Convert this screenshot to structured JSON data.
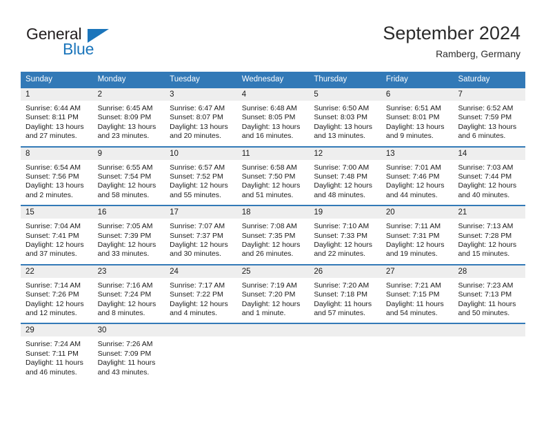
{
  "brand": {
    "name_dark": "General",
    "name_blue": "Blue",
    "accent_color": "#1b75bb"
  },
  "header": {
    "title": "September 2024",
    "subtitle": "Ramberg, Germany"
  },
  "theme": {
    "header_blue": "#3279b7",
    "day_band_gray": "#eeeeee",
    "text": "#1a1a1a"
  },
  "weekdays": [
    "Sunday",
    "Monday",
    "Tuesday",
    "Wednesday",
    "Thursday",
    "Friday",
    "Saturday"
  ],
  "weeks": [
    [
      {
        "day": "1",
        "sunrise": "Sunrise: 6:44 AM",
        "sunset": "Sunset: 8:11 PM",
        "daylight_line1": "Daylight: 13 hours",
        "daylight_line2": "and 27 minutes."
      },
      {
        "day": "2",
        "sunrise": "Sunrise: 6:45 AM",
        "sunset": "Sunset: 8:09 PM",
        "daylight_line1": "Daylight: 13 hours",
        "daylight_line2": "and 23 minutes."
      },
      {
        "day": "3",
        "sunrise": "Sunrise: 6:47 AM",
        "sunset": "Sunset: 8:07 PM",
        "daylight_line1": "Daylight: 13 hours",
        "daylight_line2": "and 20 minutes."
      },
      {
        "day": "4",
        "sunrise": "Sunrise: 6:48 AM",
        "sunset": "Sunset: 8:05 PM",
        "daylight_line1": "Daylight: 13 hours",
        "daylight_line2": "and 16 minutes."
      },
      {
        "day": "5",
        "sunrise": "Sunrise: 6:50 AM",
        "sunset": "Sunset: 8:03 PM",
        "daylight_line1": "Daylight: 13 hours",
        "daylight_line2": "and 13 minutes."
      },
      {
        "day": "6",
        "sunrise": "Sunrise: 6:51 AM",
        "sunset": "Sunset: 8:01 PM",
        "daylight_line1": "Daylight: 13 hours",
        "daylight_line2": "and 9 minutes."
      },
      {
        "day": "7",
        "sunrise": "Sunrise: 6:52 AM",
        "sunset": "Sunset: 7:59 PM",
        "daylight_line1": "Daylight: 13 hours",
        "daylight_line2": "and 6 minutes."
      }
    ],
    [
      {
        "day": "8",
        "sunrise": "Sunrise: 6:54 AM",
        "sunset": "Sunset: 7:56 PM",
        "daylight_line1": "Daylight: 13 hours",
        "daylight_line2": "and 2 minutes."
      },
      {
        "day": "9",
        "sunrise": "Sunrise: 6:55 AM",
        "sunset": "Sunset: 7:54 PM",
        "daylight_line1": "Daylight: 12 hours",
        "daylight_line2": "and 58 minutes."
      },
      {
        "day": "10",
        "sunrise": "Sunrise: 6:57 AM",
        "sunset": "Sunset: 7:52 PM",
        "daylight_line1": "Daylight: 12 hours",
        "daylight_line2": "and 55 minutes."
      },
      {
        "day": "11",
        "sunrise": "Sunrise: 6:58 AM",
        "sunset": "Sunset: 7:50 PM",
        "daylight_line1": "Daylight: 12 hours",
        "daylight_line2": "and 51 minutes."
      },
      {
        "day": "12",
        "sunrise": "Sunrise: 7:00 AM",
        "sunset": "Sunset: 7:48 PM",
        "daylight_line1": "Daylight: 12 hours",
        "daylight_line2": "and 48 minutes."
      },
      {
        "day": "13",
        "sunrise": "Sunrise: 7:01 AM",
        "sunset": "Sunset: 7:46 PM",
        "daylight_line1": "Daylight: 12 hours",
        "daylight_line2": "and 44 minutes."
      },
      {
        "day": "14",
        "sunrise": "Sunrise: 7:03 AM",
        "sunset": "Sunset: 7:44 PM",
        "daylight_line1": "Daylight: 12 hours",
        "daylight_line2": "and 40 minutes."
      }
    ],
    [
      {
        "day": "15",
        "sunrise": "Sunrise: 7:04 AM",
        "sunset": "Sunset: 7:41 PM",
        "daylight_line1": "Daylight: 12 hours",
        "daylight_line2": "and 37 minutes."
      },
      {
        "day": "16",
        "sunrise": "Sunrise: 7:05 AM",
        "sunset": "Sunset: 7:39 PM",
        "daylight_line1": "Daylight: 12 hours",
        "daylight_line2": "and 33 minutes."
      },
      {
        "day": "17",
        "sunrise": "Sunrise: 7:07 AM",
        "sunset": "Sunset: 7:37 PM",
        "daylight_line1": "Daylight: 12 hours",
        "daylight_line2": "and 30 minutes."
      },
      {
        "day": "18",
        "sunrise": "Sunrise: 7:08 AM",
        "sunset": "Sunset: 7:35 PM",
        "daylight_line1": "Daylight: 12 hours",
        "daylight_line2": "and 26 minutes."
      },
      {
        "day": "19",
        "sunrise": "Sunrise: 7:10 AM",
        "sunset": "Sunset: 7:33 PM",
        "daylight_line1": "Daylight: 12 hours",
        "daylight_line2": "and 22 minutes."
      },
      {
        "day": "20",
        "sunrise": "Sunrise: 7:11 AM",
        "sunset": "Sunset: 7:31 PM",
        "daylight_line1": "Daylight: 12 hours",
        "daylight_line2": "and 19 minutes."
      },
      {
        "day": "21",
        "sunrise": "Sunrise: 7:13 AM",
        "sunset": "Sunset: 7:28 PM",
        "daylight_line1": "Daylight: 12 hours",
        "daylight_line2": "and 15 minutes."
      }
    ],
    [
      {
        "day": "22",
        "sunrise": "Sunrise: 7:14 AM",
        "sunset": "Sunset: 7:26 PM",
        "daylight_line1": "Daylight: 12 hours",
        "daylight_line2": "and 12 minutes."
      },
      {
        "day": "23",
        "sunrise": "Sunrise: 7:16 AM",
        "sunset": "Sunset: 7:24 PM",
        "daylight_line1": "Daylight: 12 hours",
        "daylight_line2": "and 8 minutes."
      },
      {
        "day": "24",
        "sunrise": "Sunrise: 7:17 AM",
        "sunset": "Sunset: 7:22 PM",
        "daylight_line1": "Daylight: 12 hours",
        "daylight_line2": "and 4 minutes."
      },
      {
        "day": "25",
        "sunrise": "Sunrise: 7:19 AM",
        "sunset": "Sunset: 7:20 PM",
        "daylight_line1": "Daylight: 12 hours",
        "daylight_line2": "and 1 minute."
      },
      {
        "day": "26",
        "sunrise": "Sunrise: 7:20 AM",
        "sunset": "Sunset: 7:18 PM",
        "daylight_line1": "Daylight: 11 hours",
        "daylight_line2": "and 57 minutes."
      },
      {
        "day": "27",
        "sunrise": "Sunrise: 7:21 AM",
        "sunset": "Sunset: 7:15 PM",
        "daylight_line1": "Daylight: 11 hours",
        "daylight_line2": "and 54 minutes."
      },
      {
        "day": "28",
        "sunrise": "Sunrise: 7:23 AM",
        "sunset": "Sunset: 7:13 PM",
        "daylight_line1": "Daylight: 11 hours",
        "daylight_line2": "and 50 minutes."
      }
    ],
    [
      {
        "day": "29",
        "sunrise": "Sunrise: 7:24 AM",
        "sunset": "Sunset: 7:11 PM",
        "daylight_line1": "Daylight: 11 hours",
        "daylight_line2": "and 46 minutes."
      },
      {
        "day": "30",
        "sunrise": "Sunrise: 7:26 AM",
        "sunset": "Sunset: 7:09 PM",
        "daylight_line1": "Daylight: 11 hours",
        "daylight_line2": "and 43 minutes."
      },
      {
        "day": "",
        "sunrise": "",
        "sunset": "",
        "daylight_line1": "",
        "daylight_line2": ""
      },
      {
        "day": "",
        "sunrise": "",
        "sunset": "",
        "daylight_line1": "",
        "daylight_line2": ""
      },
      {
        "day": "",
        "sunrise": "",
        "sunset": "",
        "daylight_line1": "",
        "daylight_line2": ""
      },
      {
        "day": "",
        "sunrise": "",
        "sunset": "",
        "daylight_line1": "",
        "daylight_line2": ""
      },
      {
        "day": "",
        "sunrise": "",
        "sunset": "",
        "daylight_line1": "",
        "daylight_line2": ""
      }
    ]
  ]
}
